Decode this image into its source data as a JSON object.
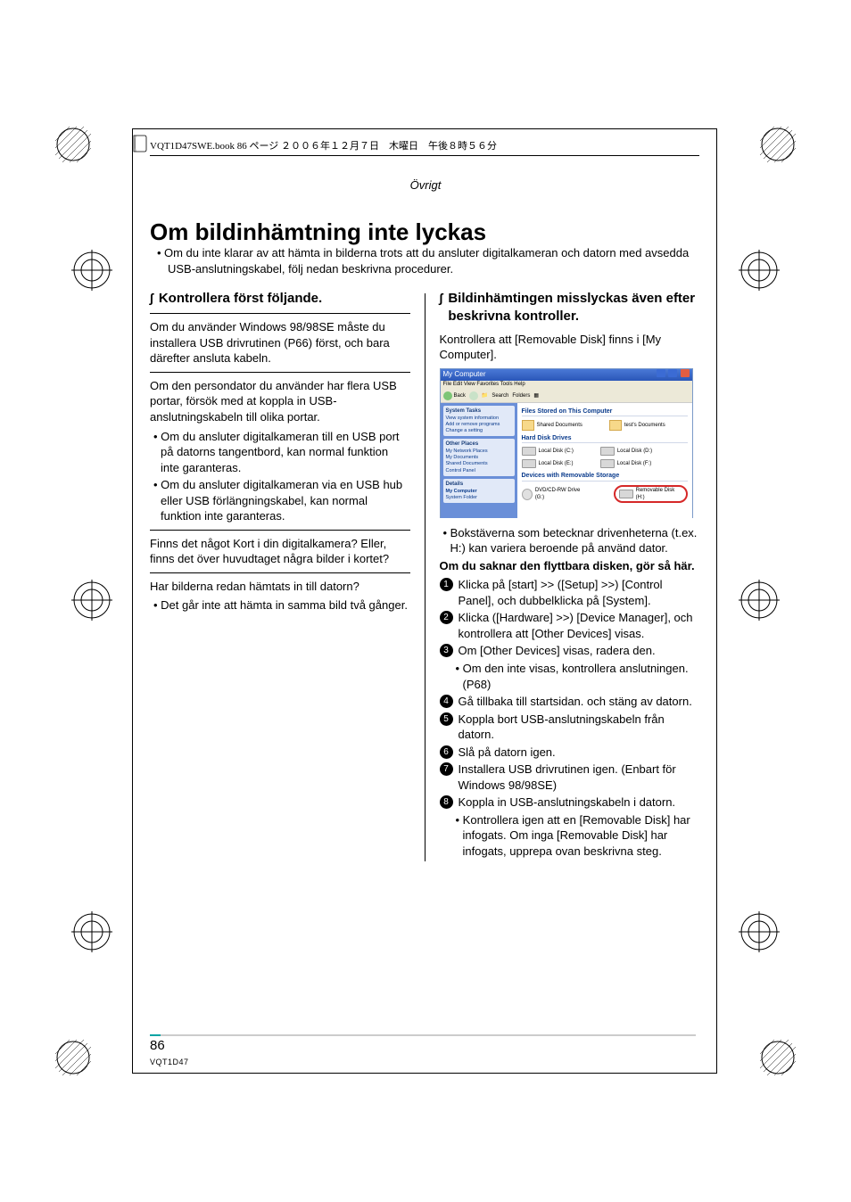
{
  "header": {
    "running_head": "VQT1D47SWE.book  86 ページ  ２００６年１２月７日　木曜日　午後８時５６分",
    "section_label": "Övrigt"
  },
  "title": "Om bildinhämtning inte lyckas",
  "intro": "Om du inte klarar av att hämta in bilderna trots att du ansluter digitalkameran och datorn med avsedda USB-anslutningskabel, följ nedan beskrivna procedurer.",
  "left": {
    "heading": "Kontrollera först följande.",
    "p1": "Om du använder Windows 98/98SE måste du installera USB drivrutinen (P66) först, och bara därefter ansluta kabeln.",
    "p2": "Om den persondator du använder har flera USB portar, försök med at koppla in USB-anslutningskabeln till olika portar.",
    "b1": "Om du ansluter digitalkameran till en USB port på datorns tangentbord, kan normal funktion inte garanteras.",
    "b2": "Om du ansluter digitalkameran via en USB hub eller USB förlängningskabel, kan normal funktion inte garanteras.",
    "p3": "Finns det något Kort i din digitalkamera? Eller, finns det över huvudtaget några bilder i kortet?",
    "p4": "Har bilderna redan hämtats in till datorn?",
    "b3": "Det går inte att hämta in samma bild två gånger."
  },
  "right": {
    "heading": "Bildinhämtingen misslyckas även efter beskrivna kontroller.",
    "p1": "Kontrollera att [Removable Disk] finns i [My Computer].",
    "b1": "Bokstäverna som betecknar drivenheterna (t.ex. H:) kan variera beroende på använd dator.",
    "bold1": "Om du saknar den flyttbara disken, gör så här.",
    "n1": "Klicka på [start] >> ([Setup] >>) [Control Panel], och dubbelklicka på [System].",
    "n2": "Klicka ([Hardware] >>) [Device Manager], och kontrollera att [Other Devices] visas.",
    "n3": "Om [Other Devices] visas, radera den.",
    "n3b": "Om den inte visas, kontrollera anslutningen. (P68)",
    "n4": "Gå tillbaka till startsidan. och stäng av datorn.",
    "n5": "Koppla bort USB-anslutningskabeln från datorn.",
    "n6": "Slå på datorn igen.",
    "n7": "Installera USB drivrutinen igen. (Enbart för Windows 98/98SE)",
    "n8": "Koppla in USB-anslutningskabeln i datorn.",
    "n8b": "Kontrollera igen att en [Removable Disk] har infogats. Om inga [Removable Disk] har infogats, upprepa ovan beskrivna steg."
  },
  "mycomputer": {
    "title": "My Computer",
    "menu": "File   Edit   View   Favorites   Tools   Help",
    "search": "Search",
    "folders": "Folders",
    "back": "Back",
    "panels": {
      "p1_title": "System Tasks",
      "p1_items": [
        "View system information",
        "Add or remove programs",
        "Change a setting"
      ],
      "p2_title": "Other Places",
      "p2_items": [
        "My Network Places",
        "My Documents",
        "Shared Documents",
        "Control Panel"
      ],
      "p3_title": "Details",
      "p3_items": [
        "My Computer",
        "System Folder"
      ]
    },
    "groups": {
      "g1": "Files Stored on This Computer",
      "g1_items": [
        "Shared Documents",
        "test's Documents"
      ],
      "g2": "Hard Disk Drives",
      "g2_items": [
        "Local Disk (C:)",
        "Local Disk (D:)",
        "Local Disk (E:)",
        "Local Disk (F:)"
      ],
      "g3": "Devices with Removable Storage",
      "g3_items": [
        "DVD/CD-RW Drive (G:)",
        "Removable Disk (H:)"
      ]
    }
  },
  "footer": {
    "page_number": "86",
    "code": "VQT1D47"
  }
}
